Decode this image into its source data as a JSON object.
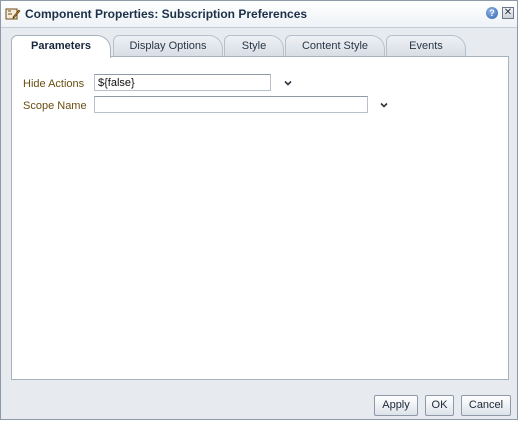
{
  "dialog": {
    "title": "Component Properties: Subscription Preferences",
    "help_symbol": "?",
    "close_symbol": "✕"
  },
  "tabs": [
    {
      "label": "Parameters",
      "active": true
    },
    {
      "label": "Display Options",
      "active": false
    },
    {
      "label": "Style",
      "active": false
    },
    {
      "label": "Content Style",
      "active": false
    },
    {
      "label": "Events",
      "active": false
    }
  ],
  "fields": [
    {
      "label": "Hide Actions",
      "value": "${false}"
    },
    {
      "label": "Scope Name",
      "value": ""
    }
  ],
  "buttons": {
    "apply": "Apply",
    "ok": "OK",
    "cancel": "Cancel"
  },
  "colors": {
    "field_label": "#6a4e11",
    "dialog_bg": "#e7ebf0",
    "title_text": "#1c3049"
  }
}
